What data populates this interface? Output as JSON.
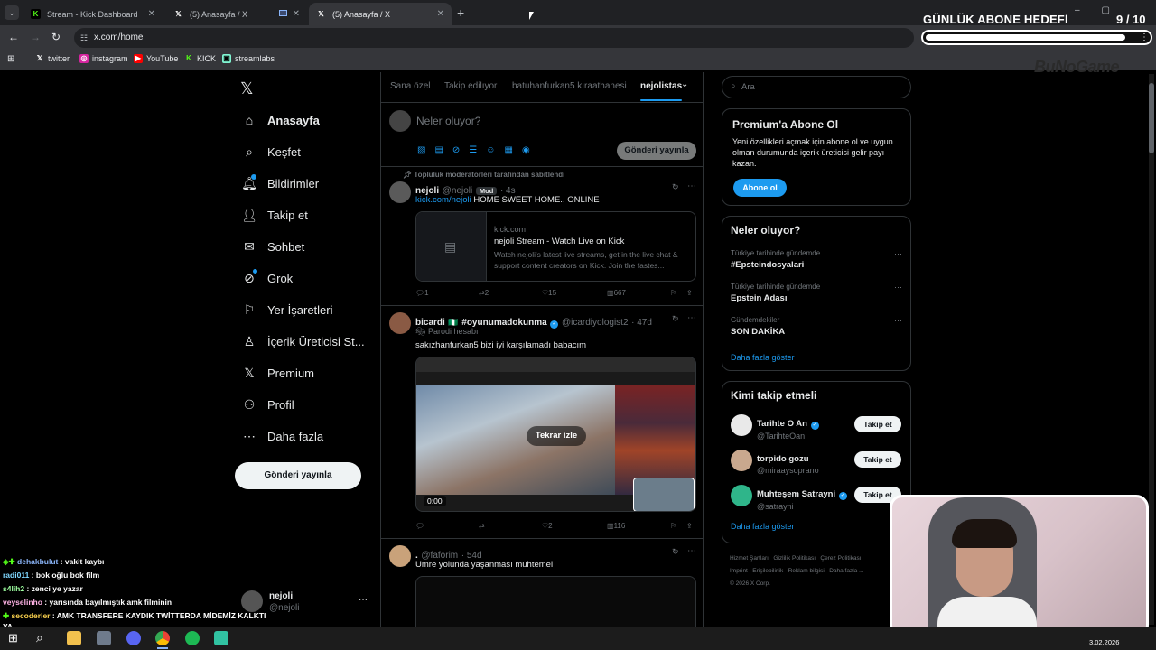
{
  "browser": {
    "tabs": [
      {
        "label": "Stream - Kick Dashboard",
        "active": false
      },
      {
        "label": "(5) Anasayfa / X",
        "active": false
      },
      {
        "label": "(5) Anasayfa / X",
        "active": true
      }
    ],
    "new_tab": "+",
    "url": "x.com/home",
    "bookmarks": [
      "twitter",
      "instagram",
      "YouTube",
      "KICK",
      "streamlabs"
    ]
  },
  "overlay": {
    "goal_title": "GÜNLÜK ABONE HEDEFİ",
    "goal_count": "9 / 10",
    "goal_progress": 0.9,
    "brand": "BuNoGame"
  },
  "nav": {
    "items": [
      "Anasayfa",
      "Keşfet",
      "Bildirimler",
      "Takip et",
      "Sohbet",
      "Grok",
      "Yer İşaretleri",
      "İçerik Üreticisi St...",
      "Premium",
      "Profil",
      "Daha fazla"
    ],
    "post_button": "Gönderi yayınla",
    "account_name": "nejoli",
    "account_handle": "@nejoli",
    "account_more": "···"
  },
  "main": {
    "tabs": [
      "Sana özel",
      "Takip edilıyor",
      "batuhanfurkan5 kıraathanesi",
      "nejolistas"
    ],
    "composer_placeholder": "Neler oluyor?",
    "composer_post": "Gönderi yayınla",
    "pinned_label": "Topluluk moderatörleri tarafından sabitlendi",
    "tweets": [
      {
        "name": "nejoli",
        "handle": "@nejoli",
        "badge": "Mod",
        "time": "· 4s",
        "link": "kick.com/nejoli",
        "text": " HOME SWEET HOME.. ONLINE",
        "card_domain": "kick.com",
        "card_title": "nejoli Stream - Watch Live on Kick",
        "card_desc": "Watch nejoli's latest live streams, get in the live chat & support content creators on Kick. Join the fastes...",
        "replies": "1",
        "reposts": "2",
        "likes": "15",
        "views": "667"
      },
      {
        "name": "bicardi",
        "flag": "🇳🇬",
        "tag": "#oyunumadokunma",
        "handle": "@icardiyologist2",
        "time": "· 47d",
        "parody": "Parodi hesabı",
        "text": "sakızhanfurkan5 bizi iyi karşılamadı babacım",
        "replay": "Tekrar izle",
        "video_time": "0:00",
        "replies": "",
        "reposts": "",
        "likes": "2",
        "views": "116"
      },
      {
        "name": ".",
        "handle": "@faforim",
        "time": "· 54d",
        "text": "Umre yolunda yaşanması muhtemel"
      }
    ]
  },
  "right": {
    "search_placeholder": "Ara",
    "premium": {
      "title": "Premium'a Abone Ol",
      "body": "Yeni özellikleri açmak için abone ol ve uygun olman durumunda içerik üreticisi gelir payı kazan.",
      "button": "Abone ol"
    },
    "trends": {
      "title": "Neler oluyor?",
      "items": [
        {
          "context": "Türkiye tarihinde gündemde",
          "title": "#Epsteindosyalari"
        },
        {
          "context": "Türkiye tarihinde gündemde",
          "title": "Epstein Adası"
        },
        {
          "context": "Gündemdekiler",
          "title": "SON DAKİKA"
        }
      ],
      "more": "Daha fazla göster"
    },
    "follow": {
      "title": "Kimi takip etmeli",
      "items": [
        {
          "name": "Tarihte O An",
          "handle": "@TarihteOan",
          "verified": true
        },
        {
          "name": "torpido gozu",
          "handle": "@miraaysoprano",
          "verified": false
        },
        {
          "name": "Muhteşem Satrayni",
          "handle": "@satrayni",
          "verified": true
        }
      ],
      "button": "Takip et",
      "more": "Daha fazla göster"
    },
    "footer": [
      "Hizmet Şartları",
      "Gizlilik Politikası",
      "Çerez Politikası",
      "Imprint",
      "Erişilebilirlik",
      "Reklam bilgisi",
      "Daha fazla ...",
      "© 2026 X Corp."
    ]
  },
  "chat": [
    {
      "user": "dehakbulut",
      "msg": " : vakit kaybı"
    },
    {
      "user": "radi011",
      "msg": " : bok oğlu bok film"
    },
    {
      "user": "s4lih2",
      "msg": " : zenci ye yazar"
    },
    {
      "user": "veyselinho",
      "msg": " : yarısında bayılmıştık amk filminin"
    },
    {
      "user": "secoderler",
      "msg": " : AMK TRANSFERE KAYDIK TWİTTERDA MİDEMİZ KALKTI"
    },
    {
      "user": "",
      "msg": "YA"
    }
  ],
  "taskbar": {
    "date": "3.02.2026"
  }
}
